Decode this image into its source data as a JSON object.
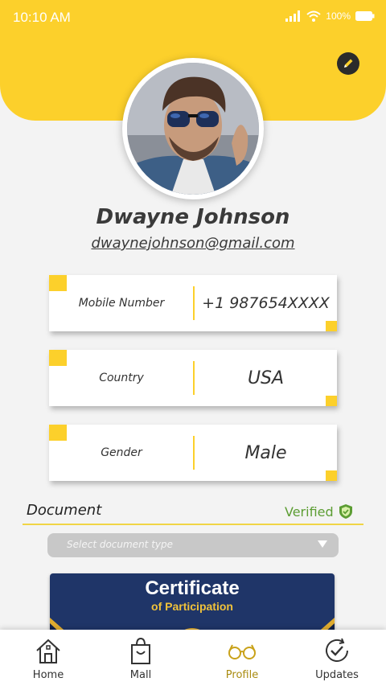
{
  "status_bar": {
    "time": "10:10 AM",
    "battery": "100%"
  },
  "profile": {
    "name": "Dwayne Johnson",
    "email": "dwaynejohnson@gmail.com"
  },
  "fields": [
    {
      "label": "Mobile Number",
      "value": "+1 987654XXXX"
    },
    {
      "label": "Country",
      "value": "USA"
    },
    {
      "label": "Gender",
      "value": "Male"
    }
  ],
  "document": {
    "title": "Document",
    "status": "Verified",
    "select_placeholder": "Select document type",
    "certificate_title": "Certificate",
    "certificate_subtitle": "of Participation"
  },
  "nav": [
    {
      "label": "Home",
      "icon": "home-icon"
    },
    {
      "label": "Mall",
      "icon": "shopping-bag-icon"
    },
    {
      "label": "Profile",
      "icon": "glasses-icon"
    },
    {
      "label": "Updates",
      "icon": "refresh-check-icon"
    }
  ],
  "colors": {
    "accent": "#fcd02b",
    "verified": "#5c9d33",
    "certificate": "#1f3568"
  }
}
